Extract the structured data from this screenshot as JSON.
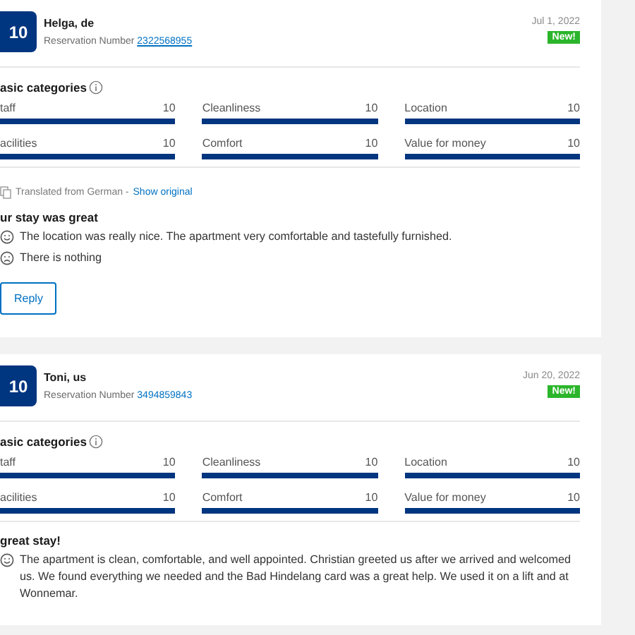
{
  "reviews": [
    {
      "score": "10",
      "name": "Helga, de",
      "reservation_label": "Reservation Number",
      "reservation_number": "2322568955",
      "reservation_underlined": true,
      "date": "Jul 1, 2022",
      "badge": "New!",
      "categories_title": "asic categories",
      "categories": [
        {
          "label": "taff",
          "value": "10",
          "level": 1
        },
        {
          "label": "Cleanliness",
          "value": "10",
          "level": 1
        },
        {
          "label": "Location",
          "value": "10",
          "level": 1
        },
        {
          "label": "acilities",
          "value": "10",
          "level": 1
        },
        {
          "label": "Comfort",
          "value": "10",
          "level": 1
        },
        {
          "label": "Value for money",
          "value": "10",
          "level": 1
        }
      ],
      "translation": {
        "text": "Translated from German -",
        "link": "Show original"
      },
      "title": "ur stay was great",
      "comments": [
        {
          "kind": "positive",
          "text": "The location was really nice. The apartment very comfortable and tastefully furnished."
        },
        {
          "kind": "negative",
          "text": "There is nothing"
        }
      ],
      "reply_button": "Reply"
    },
    {
      "score": "10",
      "name": "Toni, us",
      "reservation_label": "Reservation Number",
      "reservation_number": "3494859843",
      "reservation_underlined": false,
      "date": "Jun 20, 2022",
      "badge": "New!",
      "categories_title": "asic categories",
      "categories": [
        {
          "label": "taff",
          "value": "10",
          "level": 1
        },
        {
          "label": "Cleanliness",
          "value": "10",
          "level": 1
        },
        {
          "label": "Location",
          "value": "10",
          "level": 1
        },
        {
          "label": "acilities",
          "value": "10",
          "level": 1
        },
        {
          "label": "Comfort",
          "value": "10",
          "level": 1
        },
        {
          "label": "Value for money",
          "value": "10",
          "level": 1
        }
      ],
      "title": "great stay!",
      "comments": [
        {
          "kind": "positive",
          "text": "The apartment is clean, comfortable, and well appointed. Christian greeted us after we arrived and welcomed us. We found everything we needed and the Bad Hindelang card was a great help. We used it on a lift and at Wonnemar."
        }
      ]
    }
  ]
}
